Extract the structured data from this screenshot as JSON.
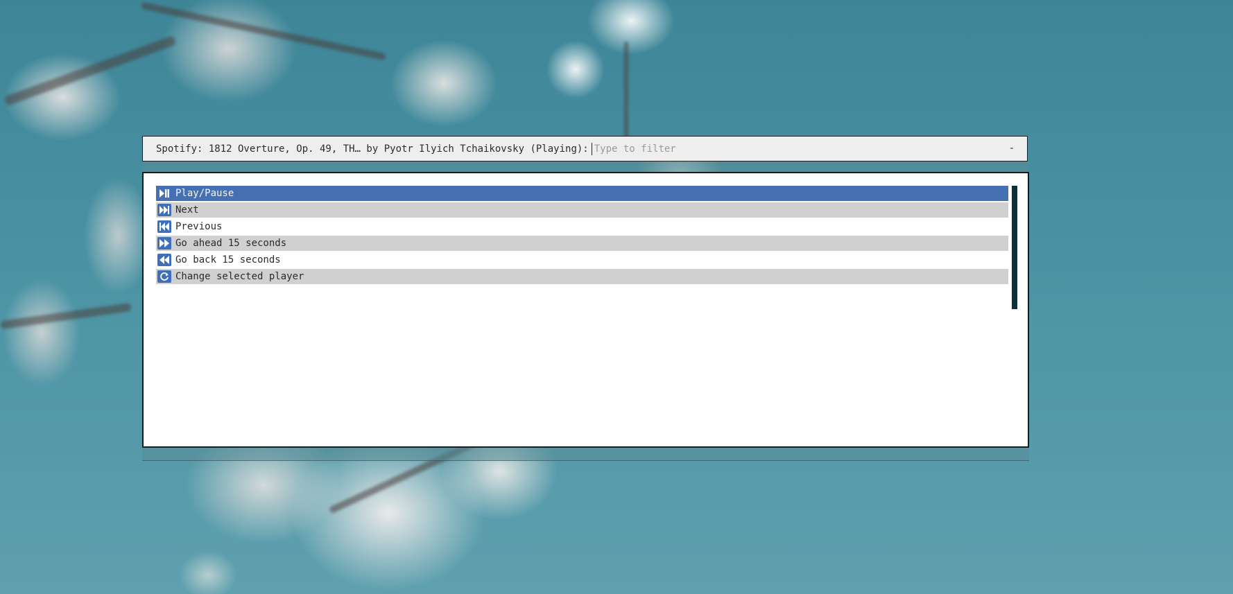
{
  "window": {
    "prompt": "Spotify: 1812 Overture, Op. 49, TH… by Pyotr Ilyich Tchaikovsky (Playing):",
    "filter_placeholder": "Type to filter",
    "filter_value": "",
    "minimize_label": "-"
  },
  "colors": {
    "selected_bg": "#4570b2",
    "alt_row_bg": "#d0d0d0",
    "icon_bg": "#3e6fb8",
    "scrollbar": "#0d2f38"
  },
  "items": [
    {
      "label": "Play/Pause",
      "icon": "play-pause-icon",
      "selected": true
    },
    {
      "label": "Next",
      "icon": "skip-next-icon",
      "selected": false
    },
    {
      "label": "Previous",
      "icon": "skip-previous-icon",
      "selected": false
    },
    {
      "label": "Go ahead 15 seconds",
      "icon": "fast-forward-icon",
      "selected": false
    },
    {
      "label": "Go back 15 seconds",
      "icon": "rewind-icon",
      "selected": false
    },
    {
      "label": "Change selected player",
      "icon": "refresh-icon",
      "selected": false
    }
  ]
}
